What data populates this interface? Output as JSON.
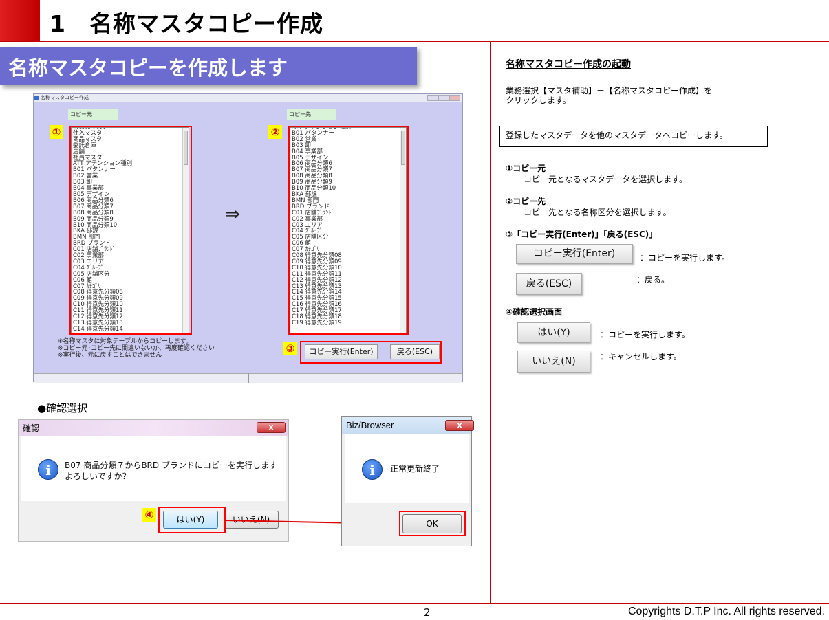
{
  "header": {
    "title": "1　名称マスタコピー作成"
  },
  "banner": "名称マスタコピーを作成します",
  "app": {
    "window_title": "名称マスタコピー作成",
    "source_label": "コピー元",
    "dest_label": "コピー先",
    "arrow": "⇒",
    "source_items": [
      "得意先マスタ",
      "仕入マスタ",
      "商品マスタ",
      "委託倉庫",
      "店舗",
      "社員マスタ",
      "ATT アテンション種別",
      "B01 パタンナー",
      "B02 営業",
      "B03 卸",
      "B04 事業部",
      "B05 デザイン",
      "B06 商品分類6",
      "B07 商品分類7",
      "B08 商品分類8",
      "B09 商品分類9",
      "B10 商品分類10",
      "BKA 部課",
      "BMN 部門",
      "BRD ブランド",
      "C01 店舗ﾌﾞﾗﾝﾄﾞ",
      "C02 事業部",
      "C03 エリア",
      "C04 ｸﾞﾙｰﾌﾟ",
      "C05 店舗区分",
      "C06 館",
      "C07 ｶﾃｺﾞﾘ",
      "C08 得意先分類08",
      "C09 得意先分類09",
      "C10 得意先分類10",
      "C11 得意先分類11",
      "C12 得意先分類12",
      "C13 得意先分類13",
      "C14 得意先分類14"
    ],
    "dest_items": [
      "ATT アテンション種別",
      "B01 パタンナー",
      "B02 営業",
      "B03 卸",
      "B04 事業部",
      "B05 デザイン",
      "B06 商品分類6",
      "B07 商品分類7",
      "B08 商品分類8",
      "B09 商品分類9",
      "B10 商品分類10",
      "BKA 部課",
      "BMN 部門",
      "BRD ブランド",
      "C01 店舗ﾌﾞﾗﾝﾄﾞ",
      "C02 事業部",
      "C03 エリア",
      "C04 ｸﾞﾙｰﾌﾟ",
      "C05 店舗区分",
      "C06 館",
      "C07 ｶﾃｺﾞﾘ",
      "C08 得意先分類08",
      "C09 得意先分類09",
      "C10 得意先分類10",
      "C11 得意先分類11",
      "C12 得意先分類12",
      "C13 得意先分類13",
      "C14 得意先分類14",
      "C15 得意先分類15",
      "C16 得意先分類16",
      "C17 得意先分類17",
      "C18 得意先分類18",
      "C19 得意先分類19"
    ],
    "notes": [
      "※名称マスタに対象テーブルからコピーします。",
      "※コピー元･コピー先に間違いないか、再度確認ください",
      "※実行後、元に戻すことはできません"
    ],
    "execute_button": "コピー実行(Enter)",
    "back_button": "戻る(ESC)"
  },
  "markers": [
    "①",
    "②",
    "③",
    "④"
  ],
  "confirm_section_label": "●確認選択",
  "dialog_confirm": {
    "title": "確認",
    "message_line1": "B07 商品分類７からBRD ブランドにコピーを実行します",
    "message_line2": "よろしいですか？",
    "yes_button": "はい(Y)",
    "no_button": "いいえ(N)",
    "close": "x"
  },
  "dialog_done": {
    "title": "Biz/Browser",
    "message": "正常更新終了",
    "ok_button": "OK",
    "close": "x"
  },
  "right_panel": {
    "heading": "名称マスタコピー作成の起動",
    "intro_line1": "業務選択【マスタ補助】－【名称マスタコピー作成】を",
    "intro_line2": "クリックします。",
    "box_text": "登録したマスタデータを他のマスタデータへコピーします。",
    "s1_title": "①コピー元",
    "s1_desc": "コピー元となるマスタデータを選択します。",
    "s2_title": "②コピー先",
    "s2_desc": "コピー先となる名称区分を選択します。",
    "s3_title": "③「コピー実行(Enter)」「戻る(ESC)」",
    "exec_btn": "コピー実行(Enter)",
    "exec_desc": "：コピーを実行します。",
    "back_btn": "戻る(ESC)",
    "back_desc": "：戻る。",
    "s4_title": "④確認選択画面",
    "yes_btn": "はい(Y)",
    "yes_desc": "：コピーを実行します。",
    "no_btn": "いいえ(N)",
    "no_desc": "：キャンセルします。"
  },
  "footer": {
    "page": "2",
    "copyright": "Copyrights  D.T.P Inc. All rights reserved."
  }
}
